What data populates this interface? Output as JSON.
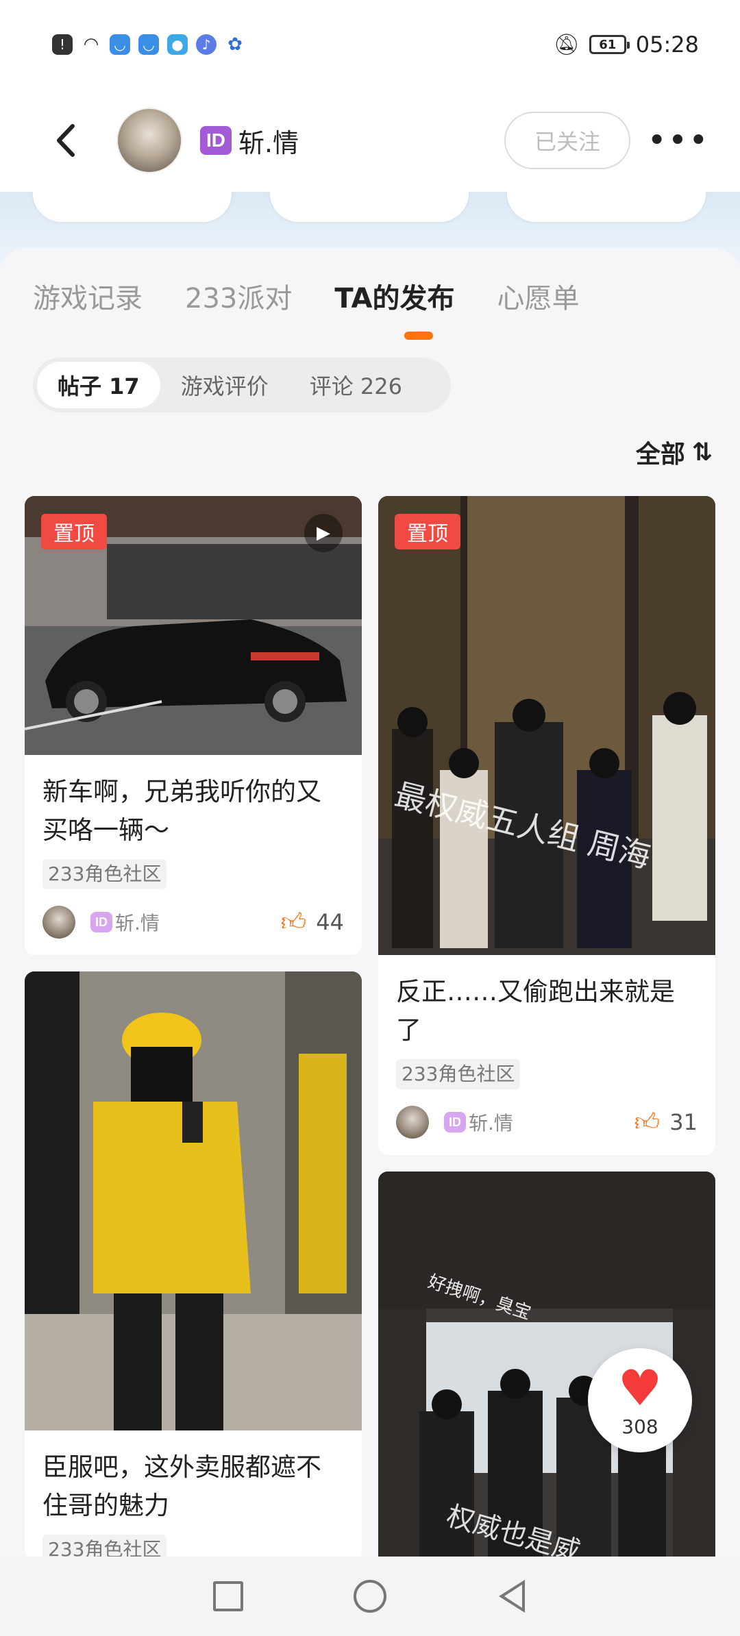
{
  "status_bar": {
    "time": "05:28",
    "battery": "61",
    "icons": [
      "alert-icon",
      "wifi-icon",
      "app-icon-1",
      "app-icon-2",
      "weather-icon",
      "music-icon",
      "baidu-icon"
    ],
    "silent_icon": "bell-off-icon"
  },
  "header": {
    "back_label": "‹",
    "id_badge": "ID",
    "username": "斩.情",
    "follow_label": "已关注",
    "more_label": "•••"
  },
  "tabs": [
    {
      "label": "游戏记录"
    },
    {
      "label": "233派对"
    },
    {
      "label": "TA的发布",
      "active": true
    },
    {
      "label": "心愿单"
    }
  ],
  "subtabs": [
    {
      "label": "帖子 17",
      "active": true
    },
    {
      "label": "游戏评价"
    },
    {
      "label": "评论 226"
    }
  ],
  "sort": {
    "label": "全部",
    "icon": "sort-icon"
  },
  "posts": [
    {
      "pinned_label": "置顶",
      "title": "新车啊，兄弟我听你的又买咯一辆～",
      "tag": "233角色社区",
      "author_badge": "ID",
      "author": "斩.情",
      "likes": "44",
      "has_video": true
    },
    {
      "pinned_label": "置顶",
      "title": "反正……又偷跑出来就是了",
      "tag": "233角色社区",
      "author_badge": "ID",
      "author": "斩.情",
      "likes": "31",
      "overlay_text": "最权威五人组 周海"
    },
    {
      "title": "臣服吧，这外卖服都遮不住哥的魅力",
      "tag": "233角色社区"
    },
    {
      "overlay_text_top": "好拽啊，臭宝",
      "overlay_text_bottom": "权威也是威"
    }
  ],
  "heart_fab": {
    "count": "308"
  },
  "colors": {
    "accent": "#ff7210",
    "pin": "#f04a43",
    "heart": "#f53a3a",
    "id_badge": "#a35ad6"
  }
}
